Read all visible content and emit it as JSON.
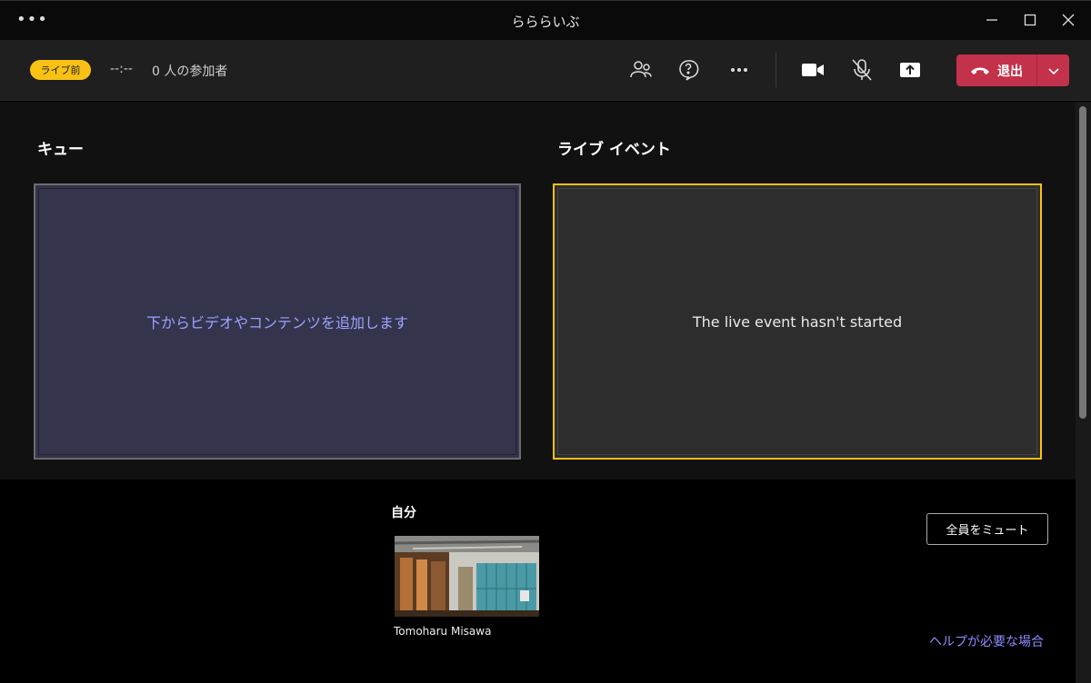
{
  "window": {
    "title": "らららいぶ",
    "menu_glyph": "•••"
  },
  "toolbar": {
    "status_badge": "ライブ前",
    "timer": "--:--",
    "participants": "0 人の参加者",
    "icons": [
      "participants-icon",
      "qa-icon",
      "more-icon",
      "camera-icon",
      "mic-off-icon",
      "share-icon"
    ],
    "leave_label": "退出"
  },
  "queue": {
    "title": "キュー",
    "placeholder": "下からビデオやコンテンツを追加します"
  },
  "live_event": {
    "title": "ライブ イベント",
    "status": "The live event hasn't started"
  },
  "self": {
    "label": "自分",
    "name": "Tomoharu Misawa"
  },
  "actions": {
    "mute_all": "全員をミュート",
    "help": "ヘルプが必要な場合"
  },
  "colors": {
    "badge": "#f8c114",
    "leave": "#c4314b",
    "accent_text": "#9ea2ff",
    "live_border": "#f8c114"
  }
}
